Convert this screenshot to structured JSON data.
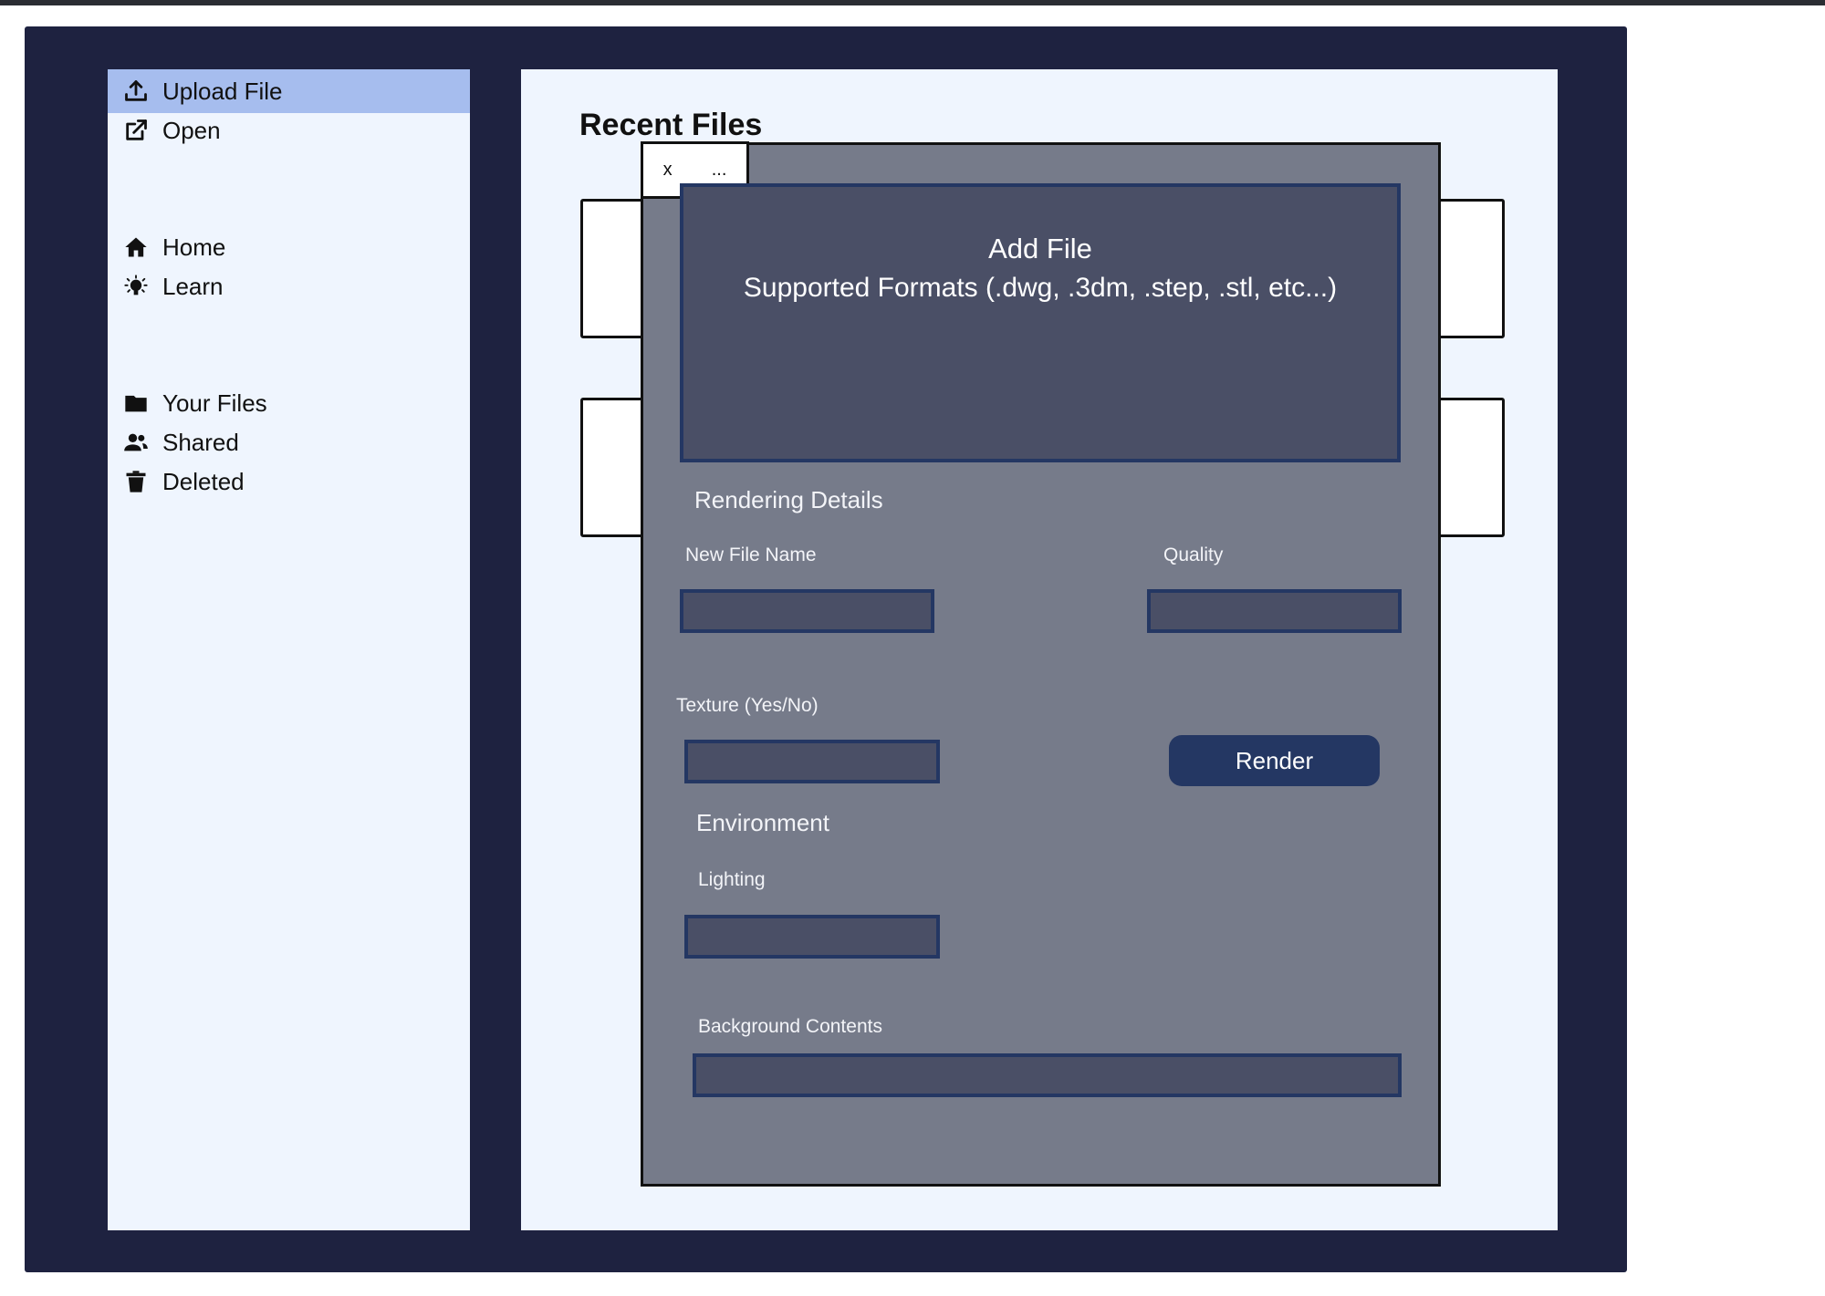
{
  "sidebar": {
    "items": [
      {
        "label": "Upload File",
        "icon": "upload-icon",
        "active": true
      },
      {
        "label": "Open",
        "icon": "external-link-icon"
      },
      {
        "label": "Home",
        "icon": "home-icon"
      },
      {
        "label": "Learn",
        "icon": "lightbulb-icon"
      },
      {
        "label": "Your Files",
        "icon": "folder-icon"
      },
      {
        "label": "Shared",
        "icon": "users-icon"
      },
      {
        "label": "Deleted",
        "icon": "trash-icon"
      }
    ]
  },
  "main": {
    "title": "Recent Files"
  },
  "dialog": {
    "tab_close": "x",
    "tab_more": "...",
    "dropzone": {
      "title": "Add File",
      "subtitle": "Supported Formats (.dwg,  .3dm, .step, .stl, etc...)"
    },
    "rendering_details": {
      "title": "Rendering Details",
      "new_file_name_label": "New File Name",
      "quality_label": "Quality",
      "texture_label": "Texture (Yes/No)",
      "render_button": "Render"
    },
    "environment": {
      "title": "Environment",
      "lighting_label": "Lighting",
      "background_label": "Background Contents"
    }
  },
  "colors": {
    "frame": "#1e2240",
    "panel": "#eff5fe",
    "active_item": "#a6bdee",
    "dialog": "#767b8a",
    "input": "#4a4f66",
    "accent": "#243763"
  }
}
